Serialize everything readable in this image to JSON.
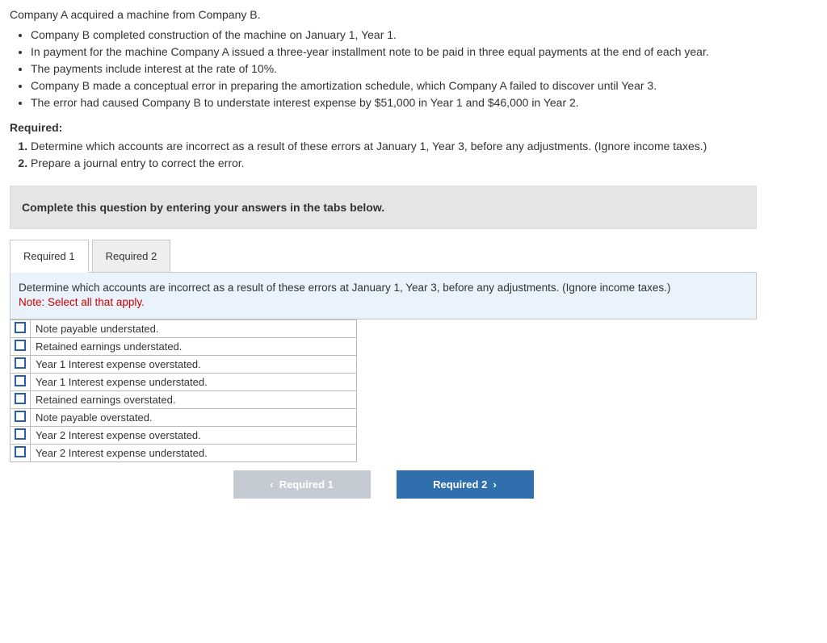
{
  "intro": "Company A acquired a machine from Company B.",
  "bullets": [
    "Company B completed construction of the machine on January 1, Year 1.",
    "In payment for the machine Company A issued a three-year installment note to be paid in three equal payments at the end of each year.",
    "The payments include interest at the rate of 10%.",
    "Company B made a conceptual error in preparing the amortization schedule, which Company A failed to discover until Year 3.",
    "The error had caused Company B to understate interest expense by $51,000 in Year 1 and $46,000 in Year 2."
  ],
  "required_heading": "Required:",
  "required_items": [
    "Determine which accounts are incorrect as a result of these errors at January 1, Year 3, before any adjustments. (Ignore income taxes.)",
    "Prepare a journal entry to correct the error."
  ],
  "instruction_bar": "Complete this question by entering your answers in the tabs below.",
  "tabs": {
    "t1": "Required 1",
    "t2": "Required 2"
  },
  "prompt": {
    "text": "Determine which accounts are incorrect as a result of these errors at January 1, Year 3, before any adjustments. (Ignore income taxes.)",
    "note": "Note: Select all that apply."
  },
  "options": [
    "Note payable understated.",
    "Retained earnings understated.",
    "Year 1 Interest expense overstated.",
    "Year 1 Interest expense understated.",
    "Retained earnings overstated.",
    "Note payable overstated.",
    "Year 2 Interest expense overstated.",
    "Year 2 Interest expense understated."
  ],
  "nav": {
    "prev": "Required 1",
    "next": "Required 2"
  }
}
